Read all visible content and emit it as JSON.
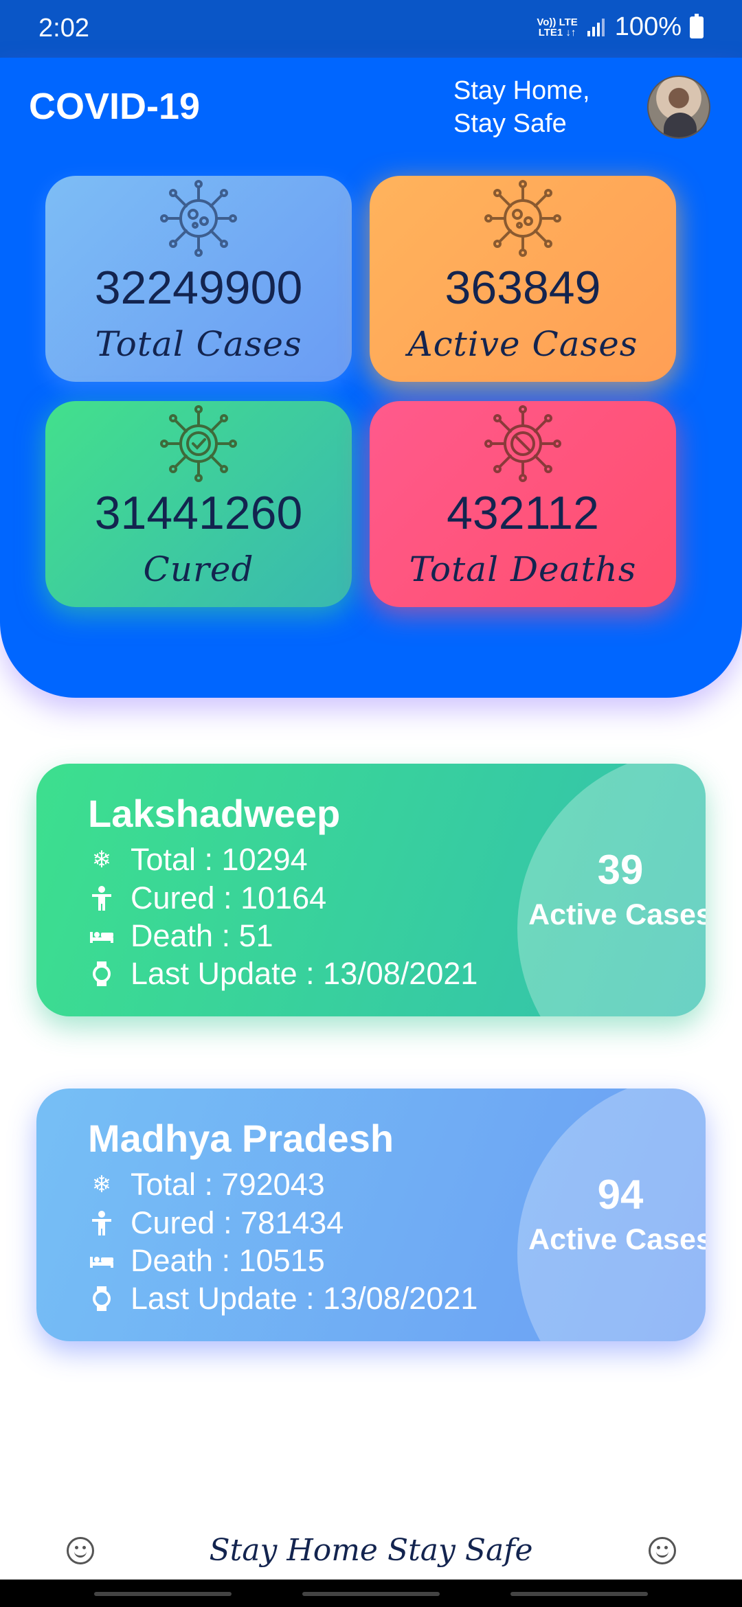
{
  "status_bar": {
    "time": "2:02",
    "network_top": "Vo)) LTE",
    "network_bottom": "LTE1 ↓↑",
    "battery": "100%"
  },
  "header": {
    "title": "COVID-19",
    "tagline_line1": "Stay Home,",
    "tagline_line2": "Stay Safe"
  },
  "stats": [
    {
      "value": "32249900",
      "label": "Total Cases",
      "icon": "virus-icon"
    },
    {
      "value": "363849",
      "label": "Active Cases",
      "icon": "virus-icon"
    },
    {
      "value": "31441260",
      "label": "Cured",
      "icon": "virus-check-icon"
    },
    {
      "value": "432112",
      "label": "Total Deaths",
      "icon": "virus-ban-icon"
    }
  ],
  "states": [
    {
      "name": "Lakshadweep",
      "total": "Total : 10294",
      "cured": "Cured : 10164",
      "death": "Death : 51",
      "last_update": "Last Update : 13/08/2021",
      "active": "39",
      "active_label": "Active Cases"
    },
    {
      "name": "Madhya Pradesh",
      "total": "Total : 792043",
      "cured": "Cured : 781434",
      "death": "Death : 10515",
      "last_update": "Last Update : 13/08/2021",
      "active": "94",
      "active_label": "Active Cases"
    }
  ],
  "footer": {
    "text": "Stay Home Stay Safe"
  },
  "colors": {
    "header_blue": "#0066ff",
    "status_blue": "#0a56c7",
    "card_blue": "#6a9cf4",
    "card_orange": "#ff9f55",
    "card_green": "#39b8b0",
    "card_red": "#ff4f6e",
    "text_navy": "#13244f"
  }
}
